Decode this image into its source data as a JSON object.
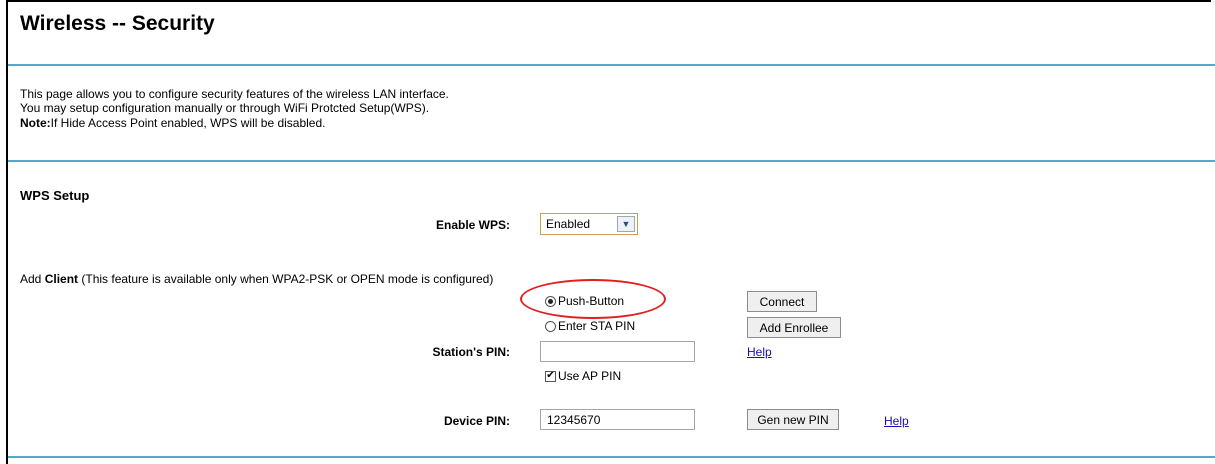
{
  "page": {
    "title": "Wireless -- Security",
    "description": {
      "line1": "This page allows you to configure security features of the wireless LAN interface.",
      "line2": "You may setup configuration manually or through WiFi Protcted Setup(WPS).",
      "note_label": "Note:",
      "note_text": "If Hide Access Point enabled, WPS will be disabled."
    }
  },
  "wps": {
    "section_title": "WPS Setup",
    "enable_label": "Enable WPS:",
    "enable_value": "Enabled",
    "add_client_prefix": "Add ",
    "add_client_bold": "Client",
    "add_client_suffix": " (This feature is available only when WPA2-PSK or OPEN mode is configured)",
    "push_button_label": "Push-Button",
    "push_button_selected": true,
    "enter_sta_pin_label": "Enter STA PIN",
    "connect_button": "Connect",
    "add_enrollee_button": "Add Enrollee",
    "station_pin_label": "Station's PIN:",
    "station_pin_value": "",
    "station_help_link": "Help",
    "use_ap_pin_label": "Use AP PIN",
    "use_ap_pin_checked": true,
    "device_pin_label": "Device PIN:",
    "device_pin_value": "12345670",
    "gen_new_pin_button": "Gen new PIN",
    "device_help_link": "Help"
  },
  "colors": {
    "rule": "#5aa6c6",
    "annotation": "#e02020",
    "link": "#1a0dab"
  },
  "icons": {
    "select_arrow": "chevron-down-icon",
    "checkbox_check": "check-icon"
  }
}
